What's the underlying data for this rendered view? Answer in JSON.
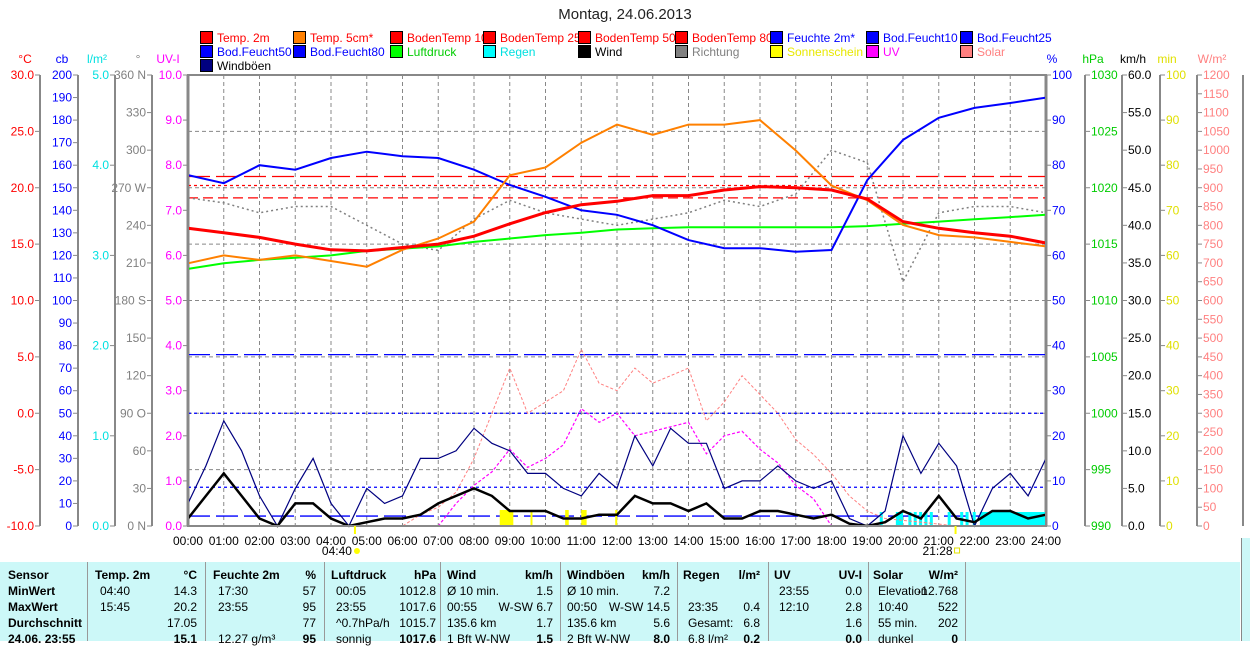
{
  "title": "Montag, 24.06.2013",
  "legend": [
    {
      "label": "Temp. 2m",
      "box": "#ff0000",
      "text": "#ff0000"
    },
    {
      "label": "Temp. 5cm*",
      "box": "#ff8000",
      "text": "#ff0000"
    },
    {
      "label": "BodenTemp 10",
      "box": "#ff0000",
      "text": "#ff0000"
    },
    {
      "label": "BodenTemp 25",
      "box": "#ff0000",
      "text": "#ff0000"
    },
    {
      "label": "BodenTemp 50",
      "box": "#ff0000",
      "text": "#ff0000"
    },
    {
      "label": "BodenTemp 80",
      "box": "#ff0000",
      "text": "#ff0000"
    },
    {
      "label": "Feuchte 2m*",
      "box": "#0000ff",
      "text": "#0000ff"
    },
    {
      "label": "Bod.Feucht10",
      "box": "#0000ff",
      "text": "#0000ff"
    },
    {
      "label": "Bod.Feucht25",
      "box": "#0000ff",
      "text": "#0000ff"
    },
    {
      "label": "Bod.Feucht50",
      "box": "#0000ff",
      "text": "#0000ff"
    },
    {
      "label": "Bod.Feucht80",
      "box": "#0000ff",
      "text": "#0000ff"
    },
    {
      "label": "Luftdruck",
      "box": "#00ff00",
      "text": "#00cc00"
    },
    {
      "label": "Regen",
      "box": "#00ffff",
      "text": "#00e0e0"
    },
    {
      "label": "Wind",
      "box": "#000000",
      "text": "#000000"
    },
    {
      "label": "Richtung",
      "box": "#808080",
      "text": "#808080"
    },
    {
      "label": "Sonnenschein",
      "box": "#ffff00",
      "text": "#e8e800"
    },
    {
      "label": "UV",
      "box": "#ff00ff",
      "text": "#ff00ff"
    },
    {
      "label": "Solar",
      "box": "#ff8080",
      "text": "#ff8080"
    },
    {
      "label": "Windböen",
      "box": "#000080",
      "text": "#000000"
    }
  ],
  "chart_data": {
    "type": "line",
    "title": "Montag, 24.06.2013",
    "x_hours_range": [
      0,
      24
    ],
    "x_tick_labels": [
      "00:00",
      "01:00",
      "02:00",
      "03:00",
      "04:00",
      "05:00",
      "06:00",
      "07:00",
      "08:00",
      "09:00",
      "10:00",
      "11:00",
      "12:00",
      "13:00",
      "14:00",
      "15:00",
      "16:00",
      "17:00",
      "18:00",
      "19:00",
      "20:00",
      "21:00",
      "22:00",
      "23:00",
      "24:00"
    ],
    "sunrise": "04:40",
    "sunset": "21:28",
    "axes": {
      "left": [
        {
          "unit": "°C",
          "color": "#ff0000",
          "range": [
            -10,
            30
          ],
          "ticks": [
            "30.0",
            "25.0",
            "20.0",
            "15.0",
            "10.0",
            "5.0",
            "0.0",
            "-5.0",
            "-10.0"
          ]
        },
        {
          "unit": "cb",
          "color": "#0000ff",
          "range": [
            0,
            200
          ],
          "ticks": [
            "200",
            "190",
            "180",
            "170",
            "160",
            "150",
            "140",
            "130",
            "120",
            "110",
            "100",
            "90",
            "80",
            "70",
            "60",
            "50",
            "40",
            "30",
            "20",
            "10",
            "0"
          ]
        },
        {
          "unit": "l/m²",
          "color": "#00e0e0",
          "range": [
            0,
            5
          ],
          "ticks": [
            "5.0",
            "4.0",
            "3.0",
            "2.0",
            "1.0",
            "0.0"
          ]
        },
        {
          "unit": "°",
          "color": "#808080",
          "range": [
            0,
            360
          ],
          "ticks": [
            "360 N",
            "330",
            "300",
            "270 W",
            "240",
            "210",
            "180 S",
            "150",
            "120",
            "90 O",
            "60",
            "30",
            "0 N"
          ]
        },
        {
          "unit": "UV-I",
          "color": "#ff00ff",
          "range": [
            0,
            10
          ],
          "ticks": [
            "10.0",
            "9.0",
            "8.0",
            "7.0",
            "6.0",
            "5.0",
            "4.0",
            "3.0",
            "2.0",
            "1.0",
            "0.0"
          ]
        }
      ],
      "right": [
        {
          "unit": "%",
          "color": "#0000ff",
          "range": [
            0,
            100
          ],
          "ticks": [
            "100",
            "90",
            "80",
            "70",
            "60",
            "50",
            "40",
            "30",
            "20",
            "10",
            "0"
          ]
        },
        {
          "unit": "hPa",
          "color": "#00cc00",
          "range": [
            990,
            1030
          ],
          "ticks": [
            "1030",
            "1025",
            "1020",
            "1015",
            "1010",
            "1005",
            "1000",
            "995",
            "990"
          ]
        },
        {
          "unit": "km/h",
          "color": "#000000",
          "range": [
            0,
            60
          ],
          "ticks": [
            "60.0",
            "55.0",
            "50.0",
            "45.0",
            "40.0",
            "35.0",
            "30.0",
            "25.0",
            "20.0",
            "15.0",
            "10.0",
            "5.0",
            "0.0"
          ]
        },
        {
          "unit": "min",
          "color": "#e0e000",
          "range": [
            0,
            100
          ],
          "ticks": [
            "100",
            "90",
            "80",
            "70",
            "60",
            "50",
            "40",
            "30",
            "20",
            "10",
            "0"
          ]
        },
        {
          "unit": "W/m²",
          "color": "#ff8080",
          "range": [
            0,
            1200
          ],
          "ticks": [
            "1200",
            "1150",
            "1100",
            "1050",
            "1000",
            "950",
            "900",
            "850",
            "800",
            "750",
            "700",
            "650",
            "600",
            "550",
            "500",
            "450",
            "400",
            "350",
            "300",
            "250",
            "200",
            "150",
            "100",
            "50",
            "0"
          ]
        }
      ]
    },
    "series_hourly": [
      {
        "name": "Temp. 2m",
        "unit": "°C",
        "color": "#ff0000",
        "values": [
          16.4,
          16.0,
          15.6,
          15.0,
          14.5,
          14.4,
          14.7,
          15.0,
          15.7,
          16.8,
          17.8,
          18.5,
          18.8,
          19.3,
          19.3,
          19.8,
          20.1,
          20.0,
          19.8,
          19.0,
          17.0,
          16.4,
          16.0,
          15.7,
          15.1
        ]
      },
      {
        "name": "Temp. 5cm*",
        "unit": "°C",
        "color": "#ff8000",
        "values": [
          13.3,
          14.0,
          13.6,
          14.0,
          13.5,
          13.0,
          14.5,
          15.5,
          17.0,
          21.1,
          21.8,
          24.0,
          25.6,
          24.7,
          25.6,
          25.6,
          26.0,
          23.3,
          20.2,
          18.9,
          16.7,
          15.8,
          15.6,
          15.2,
          14.8
        ]
      },
      {
        "name": "Feuchte 2m*",
        "unit": "%",
        "color": "#0000ff",
        "values": [
          77.8,
          76,
          80,
          79,
          81.6,
          83,
          82,
          81.6,
          79,
          75.6,
          73,
          70,
          69,
          66.7,
          63.4,
          61.6,
          61.6,
          60.8,
          61.2,
          76.7,
          85.6,
          90.5,
          92.7,
          93.8,
          95
        ]
      },
      {
        "name": "Luftdruck",
        "unit": "hPa",
        "color": "#00ff00",
        "values": [
          1012.8,
          1013.3,
          1013.6,
          1013.8,
          1014.0,
          1014.4,
          1014.6,
          1014.8,
          1015.2,
          1015.5,
          1015.8,
          1016.0,
          1016.3,
          1016.4,
          1016.5,
          1016.5,
          1016.5,
          1016.5,
          1016.5,
          1016.6,
          1016.8,
          1017.0,
          1017.2,
          1017.4,
          1017.6
        ]
      },
      {
        "name": "Richtung",
        "unit": "°",
        "color": "#808080",
        "values": [
          262,
          258,
          250,
          255,
          255,
          240,
          225,
          220,
          245,
          260,
          250,
          245,
          240,
          245,
          250,
          260,
          255,
          265,
          300,
          290,
          195,
          250,
          255,
          255,
          250
        ]
      }
    ],
    "series_halfhourly": [
      {
        "name": "Windböen",
        "unit": "km/h",
        "color": "#000080",
        "values": [
          3,
          8,
          14,
          10,
          4,
          0,
          5,
          9,
          3,
          0,
          5,
          3,
          4,
          9,
          9,
          10,
          13,
          11,
          10,
          7,
          7,
          5,
          4,
          7,
          5,
          12,
          8,
          13,
          11,
          11,
          5,
          6,
          6,
          8,
          6,
          5,
          6,
          1,
          0,
          2,
          12,
          7,
          11,
          8,
          0,
          5,
          7,
          4,
          9
        ]
      },
      {
        "name": "Wind",
        "unit": "km/h",
        "color": "#000000",
        "values": [
          1,
          4,
          7,
          4,
          1,
          0,
          3,
          3,
          1,
          0,
          0.5,
          1,
          1,
          1.5,
          3,
          4,
          5,
          4,
          2,
          2,
          2,
          1,
          1,
          1.5,
          1.5,
          4,
          3,
          3,
          2,
          3,
          1,
          1,
          2,
          2,
          1.5,
          1,
          1.5,
          0.3,
          0,
          0.5,
          2,
          1,
          4,
          1,
          0.5,
          2,
          2,
          1,
          1.5
        ]
      },
      {
        "name": "Solar",
        "unit": "W/m²",
        "color": "#ff8080",
        "values": [
          0,
          0,
          0,
          0,
          0,
          0,
          0,
          0,
          0,
          0,
          0,
          0,
          0,
          30,
          50,
          90,
          180,
          300,
          420,
          300,
          330,
          360,
          470,
          380,
          360,
          420,
          380,
          400,
          420,
          280,
          330,
          400,
          350,
          300,
          230,
          190,
          140,
          80,
          40,
          20,
          15,
          10,
          5,
          0,
          0,
          0,
          0,
          0,
          0
        ]
      },
      {
        "name": "UV",
        "unit": "UV-I",
        "color": "#ff00ff",
        "values": [
          0,
          0,
          0,
          0,
          0,
          0,
          0,
          0,
          0,
          0,
          0,
          0,
          0,
          0,
          0,
          0.5,
          0.9,
          1.2,
          1.7,
          1.3,
          1.5,
          1.8,
          2.6,
          2.3,
          2.5,
          2.0,
          2.1,
          2.2,
          2.3,
          1.6,
          2.0,
          2.1,
          1.7,
          1.4,
          0.9,
          0.6,
          0,
          0,
          0,
          0,
          0,
          0,
          0,
          0,
          0,
          0,
          0,
          0,
          0
        ]
      }
    ],
    "constant_lines": [
      {
        "name": "BodenTemp 10",
        "unit": "°C",
        "value": 21.0,
        "color": "#ff0000",
        "dash": "long"
      },
      {
        "name": "BodenTemp 25",
        "unit": "°C",
        "value": 20.2,
        "color": "#ff0000",
        "dash": "dot"
      },
      {
        "name": "BodenTemp 50",
        "unit": "°C",
        "value": 19.1,
        "color": "#ff0000",
        "dash": "medium"
      },
      {
        "name": "Bod.Feucht10",
        "unit": "%",
        "value": 38,
        "color": "#0000ff",
        "dash": "long"
      },
      {
        "name": "Bod.Feucht25",
        "unit": "%",
        "value": 25,
        "color": "#0000ff",
        "dash": "dot"
      },
      {
        "name": "Bod.Feucht50",
        "unit": "%",
        "value": 8.6,
        "color": "#0000ff",
        "dash": "dot"
      },
      {
        "name": "Bod.Feucht80",
        "unit": "%",
        "value": 2.2,
        "color": "#0000ff",
        "dash": "long"
      }
    ],
    "sunshine_hours": [
      [
        8.72,
        9.1
      ],
      [
        9.58,
        9.62
      ],
      [
        10.55,
        10.65
      ],
      [
        11.0,
        11.15
      ],
      [
        11.95,
        12.0
      ]
    ],
    "rain_hours": [
      [
        19.35,
        19.4
      ],
      [
        19.8,
        20.0
      ],
      [
        20.15,
        20.2
      ],
      [
        20.3,
        20.35
      ],
      [
        20.45,
        20.5
      ],
      [
        20.6,
        20.65
      ],
      [
        20.75,
        20.8
      ],
      [
        21.25,
        21.3
      ],
      [
        21.6,
        21.65
      ],
      [
        21.75,
        21.8
      ],
      [
        21.95,
        22.0
      ],
      [
        22.15,
        24.0
      ]
    ]
  },
  "table": {
    "headers": [
      [
        "Sensor",
        ""
      ],
      [
        "Temp. 2m",
        "°C"
      ],
      [
        "Feuchte 2m",
        "%"
      ],
      [
        "Luftdruck",
        "hPa"
      ],
      [
        "Wind",
        "km/h"
      ],
      [
        "Windböen",
        "km/h"
      ],
      [
        "Regen",
        "l/m²"
      ],
      [
        "UV",
        "UV-I"
      ],
      [
        "Solar",
        "W/m²"
      ]
    ],
    "rows": [
      {
        "label": "MinWert",
        "cells": [
          [
            "04:40",
            "14.3"
          ],
          [
            "17:30",
            "57"
          ],
          [
            "00:05",
            "1012.8"
          ],
          [
            "Ø 10 min.",
            "1.5"
          ],
          [
            "Ø 10 min.",
            "7.2"
          ],
          [
            "",
            ""
          ],
          [
            "23:55",
            "0.0"
          ],
          [
            "Elevation",
            "-12.768"
          ]
        ]
      },
      {
        "label": "MaxWert",
        "cells": [
          [
            "15:45",
            "20.2"
          ],
          [
            "23:55",
            "95"
          ],
          [
            "23:55",
            "1017.6"
          ],
          [
            "00:55",
            "W-SW 6.7"
          ],
          [
            "00:50",
            "W-SW 14.5"
          ],
          [
            "23:35",
            "0.4"
          ],
          [
            "12:10",
            "2.8"
          ],
          [
            "10:40",
            "522"
          ]
        ]
      },
      {
        "label": "Durchschnitt",
        "cells": [
          [
            "",
            "17.05"
          ],
          [
            "",
            "77"
          ],
          [
            "^0.7hPa/h",
            "1015.7"
          ],
          [
            "135.6 km",
            "1.7"
          ],
          [
            "135.6 km",
            "5.6"
          ],
          [
            "Gesamt:",
            "6.8"
          ],
          [
            "",
            "1.6"
          ],
          [
            "55 min.",
            "202"
          ]
        ]
      },
      {
        "label": "24.06. 23:55",
        "cells": [
          [
            "",
            "15.1"
          ],
          [
            "12.27 g/m³",
            "95"
          ],
          [
            "sonnig",
            "1017.6"
          ],
          [
            "1 Bft W-NW",
            "1.5"
          ],
          [
            "2 Bft W-NW",
            "8.0"
          ],
          [
            "6.8 l/m²",
            "0.2"
          ],
          [
            "",
            "0.0"
          ],
          [
            "dunkel",
            "0"
          ]
        ]
      }
    ]
  }
}
